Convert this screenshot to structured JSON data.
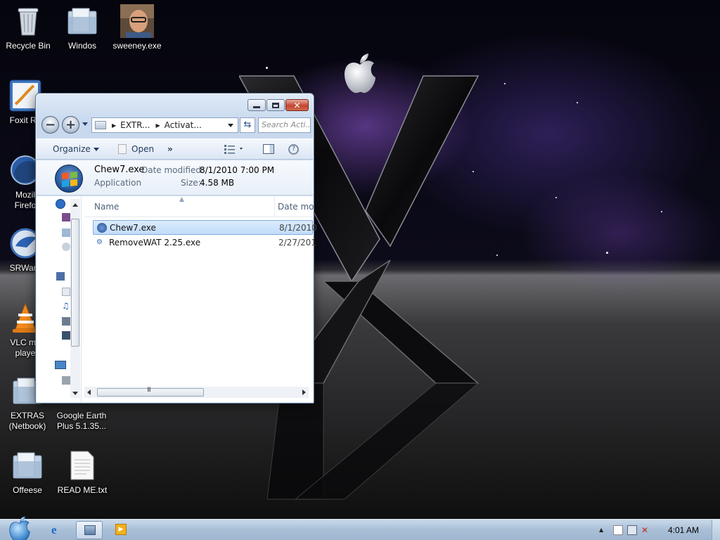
{
  "desktop": {
    "icons": [
      {
        "label": "Recycle Bin"
      },
      {
        "label": "Windos"
      },
      {
        "label": "sweeney.exe"
      },
      {
        "label": "Foxit Re"
      },
      {
        "label": "Mozil\nFirefo"
      },
      {
        "label": "SRWare"
      },
      {
        "label": "VLC me\nplaye"
      },
      {
        "label": "EXTRAS\n(Netbook)"
      },
      {
        "label": "Google Earth\nPlus 5.1.35..."
      },
      {
        "label": "Offeese"
      },
      {
        "label": "READ ME.txt"
      }
    ]
  },
  "explorer": {
    "address": {
      "crumb1": "EXTR...",
      "crumb2": "Activat..."
    },
    "search_placeholder": "Search Acti...",
    "toolbar": {
      "organize": "Organize",
      "open": "Open",
      "more": "»"
    },
    "details": {
      "name": "Chew7.exe",
      "type": "Application",
      "date_label": "Date modified:",
      "date_value": "8/1/2010 7:00 PM",
      "size_label": "Size:",
      "size_value": "4.58 MB"
    },
    "columns": {
      "name": "Name",
      "date": "Date mo"
    },
    "files": [
      {
        "name": "Chew7.exe",
        "date": "8/1/2010",
        "selected": true
      },
      {
        "name": "RemoveWAT 2.25.exe",
        "date": "2/27/201",
        "selected": false
      }
    ],
    "hscroll_grip": "III"
  },
  "taskbar": {
    "clock": "4:01 AM",
    "tray_expand": "▲"
  },
  "colors": {
    "selection": "#c1dcfc",
    "close_button": "#c44631",
    "taskbar": "#a9bfd7"
  }
}
